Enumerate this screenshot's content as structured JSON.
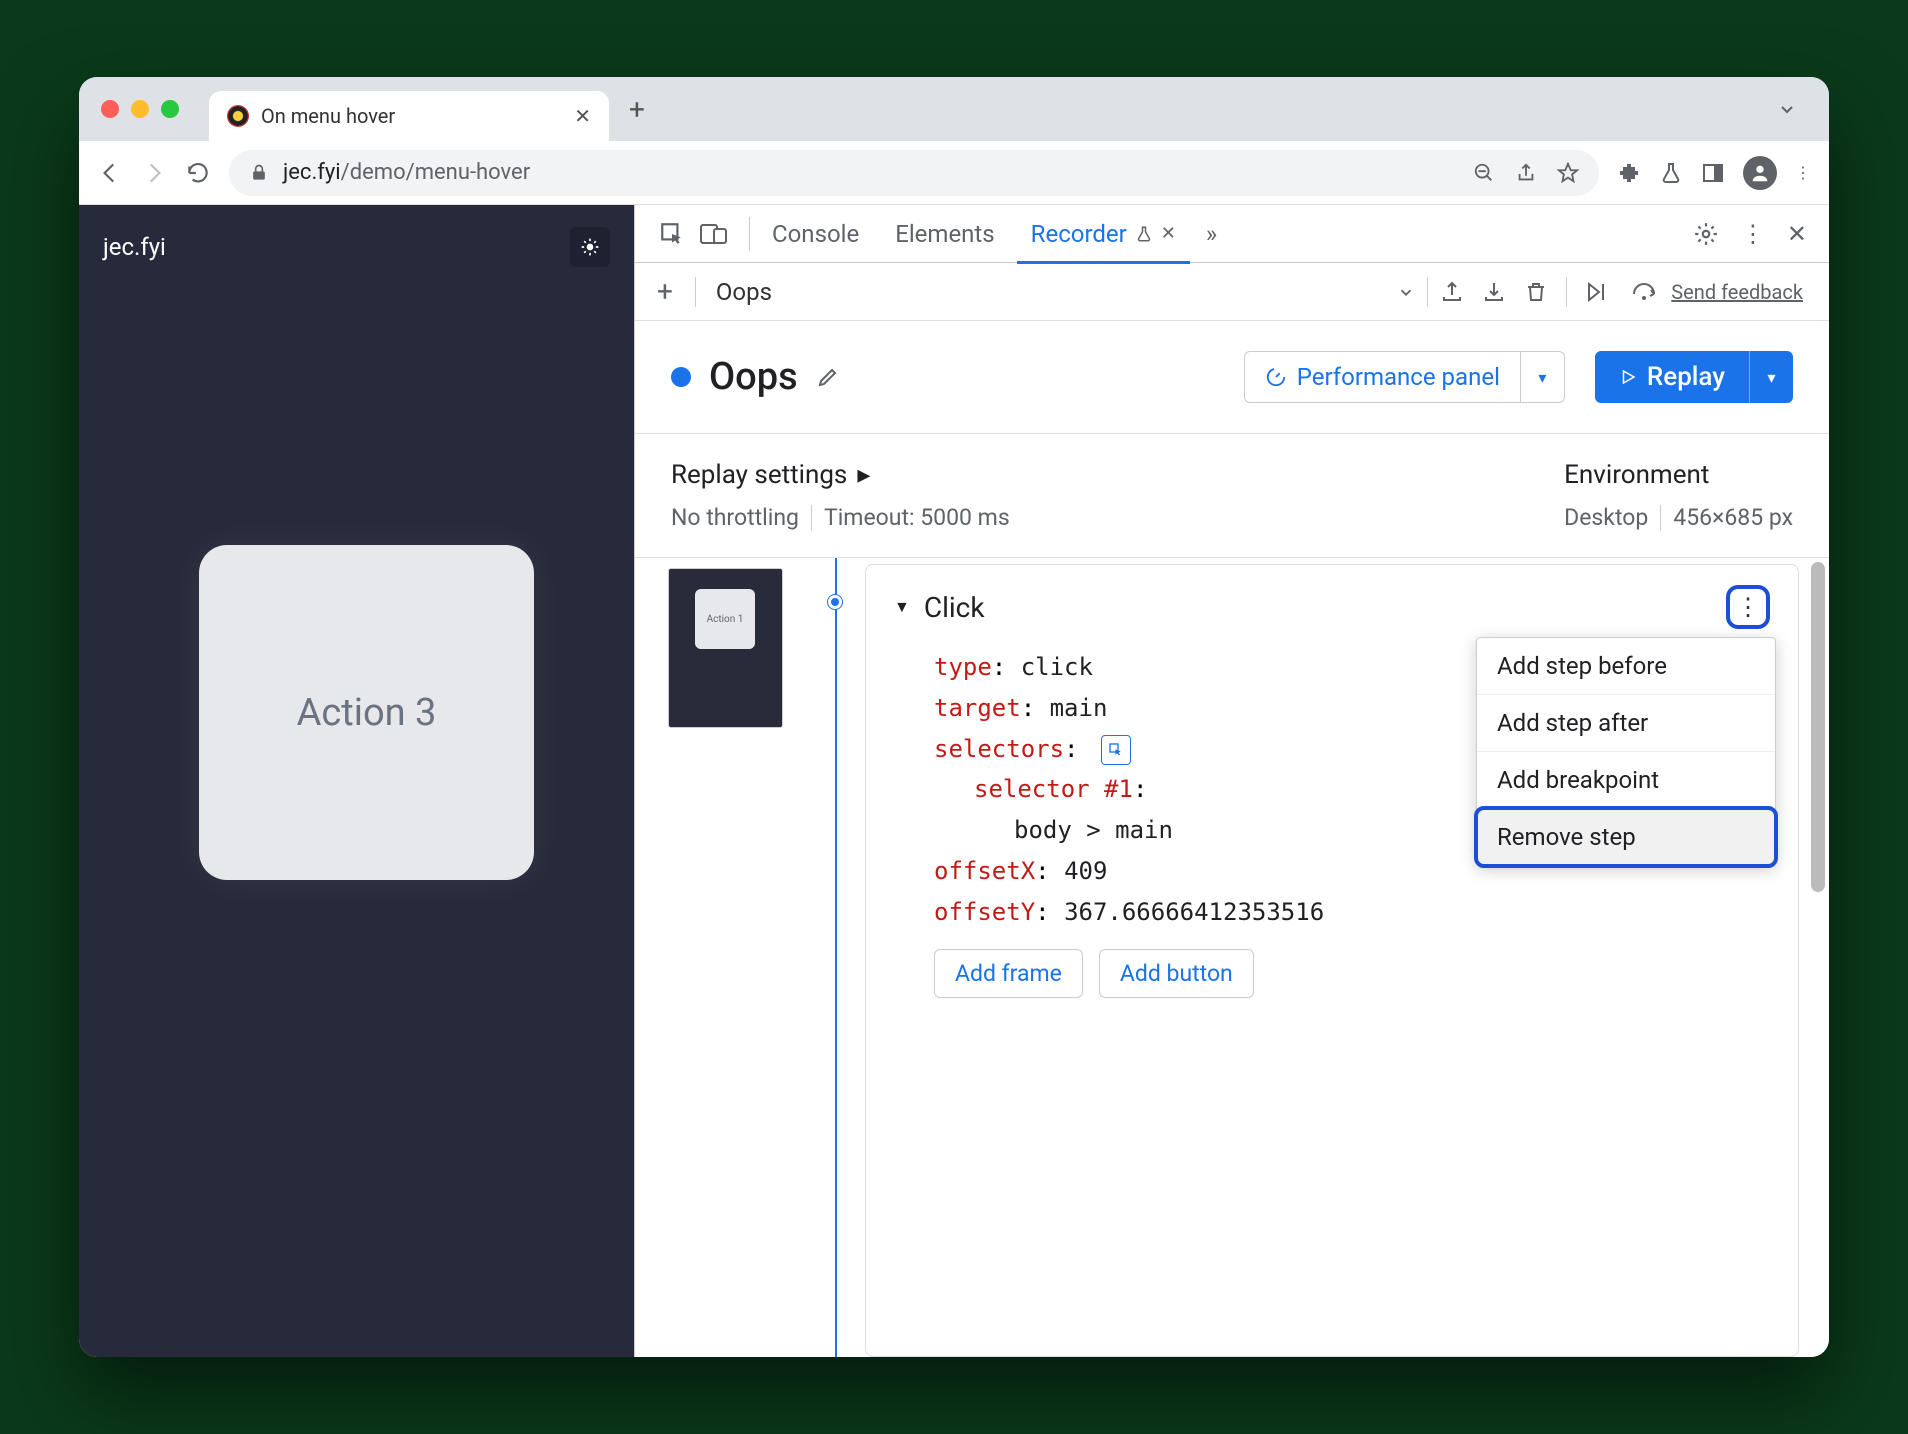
{
  "browser": {
    "tab_title": "On menu hover",
    "url_domain": "jec.fyi",
    "url_path": "/demo/menu-hover"
  },
  "page": {
    "site_title": "jec.fyi",
    "card_label": "Action 3"
  },
  "devtools": {
    "tabs": {
      "console": "Console",
      "elements": "Elements",
      "recorder": "Recorder"
    },
    "recording_name": "Oops",
    "feedback": "Send feedback",
    "title": "Oops",
    "perf_panel": "Performance panel",
    "replay": "Replay",
    "settings": {
      "replay_label": "Replay settings",
      "throttling": "No throttling",
      "timeout": "Timeout: 5000 ms",
      "env_label": "Environment",
      "env_device": "Desktop",
      "env_size": "456×685 px"
    },
    "thumb_label": "Action 1",
    "step": {
      "name": "Click",
      "type_k": "type",
      "type_v": "click",
      "target_k": "target",
      "target_v": "main",
      "selectors_k": "selectors",
      "selector_label": "selector #1",
      "selector_value": "body > main",
      "offsetx_k": "offsetX",
      "offsetx_v": "409",
      "offsety_k": "offsetY",
      "offsety_v": "367.66666412353516",
      "add_frame": "Add frame",
      "add_button": "Add button"
    },
    "ctx": {
      "before": "Add step before",
      "after": "Add step after",
      "breakpoint": "Add breakpoint",
      "remove": "Remove step"
    }
  }
}
